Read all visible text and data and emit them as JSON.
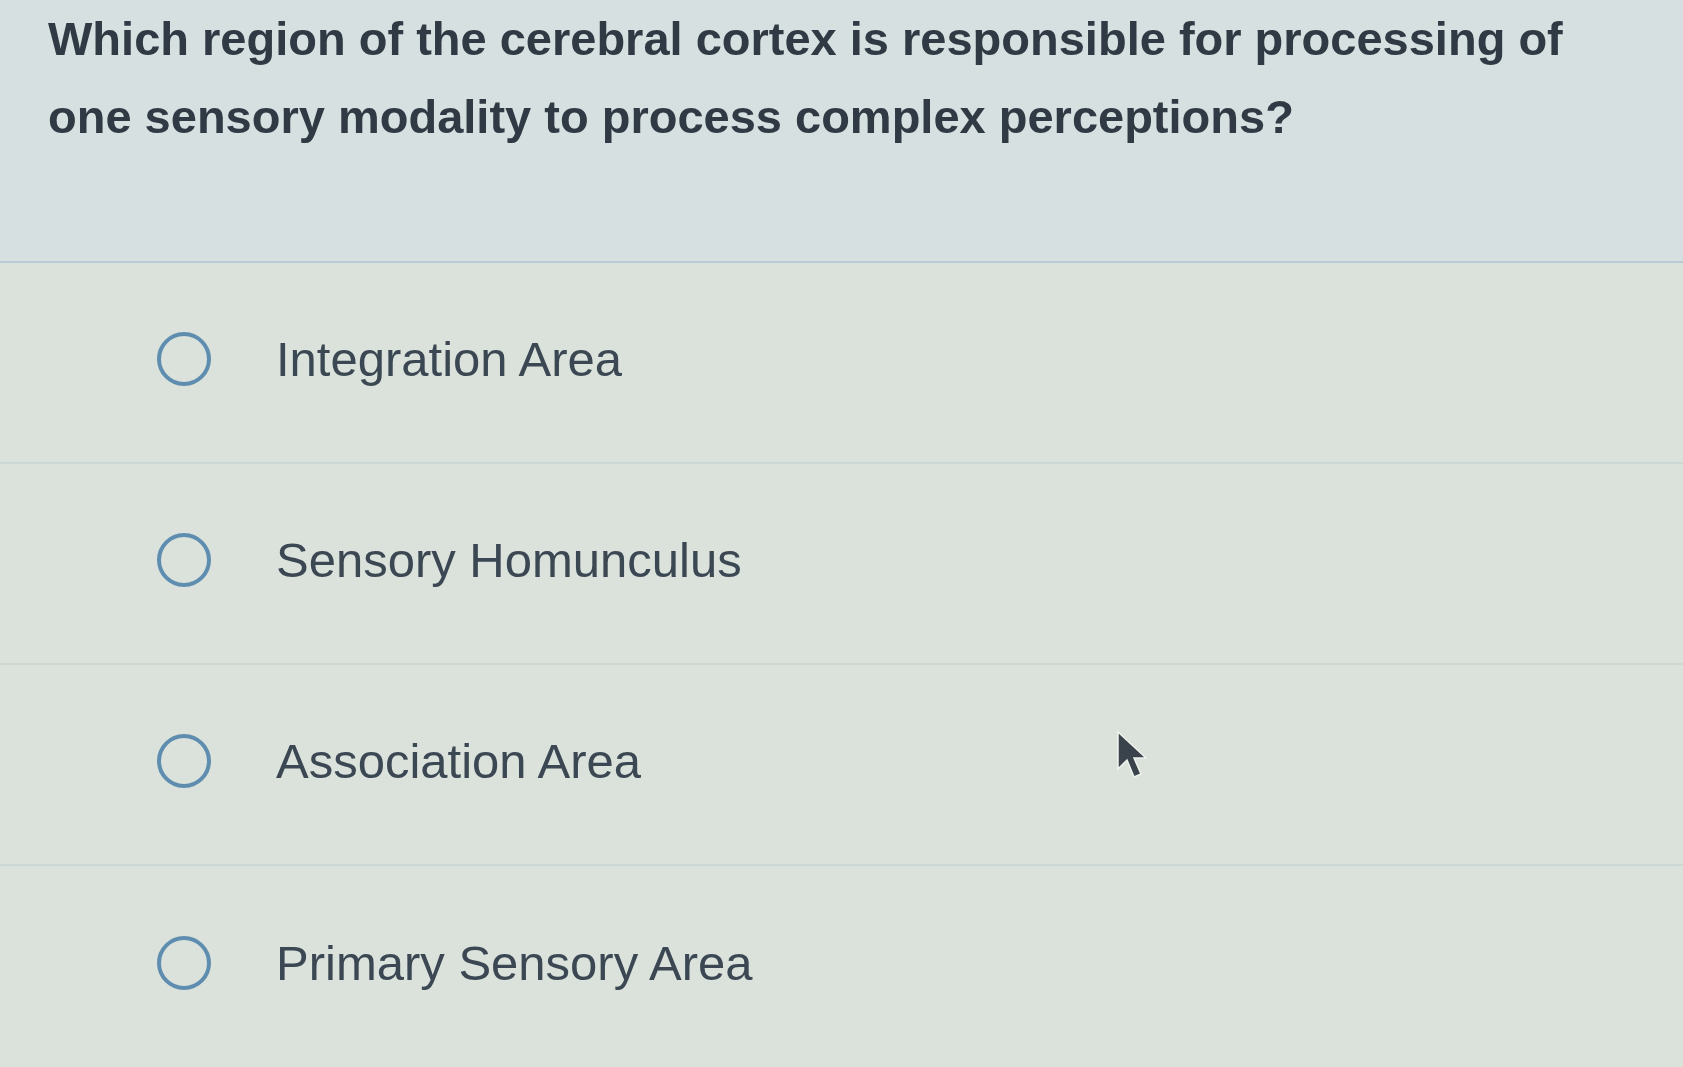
{
  "question": {
    "text": "Which region of the cerebral cortex is responsible for processing of one sensory modality to process complex perceptions?"
  },
  "options": [
    {
      "label": "Integration Area",
      "selected": false
    },
    {
      "label": "Sensory Homunculus",
      "selected": false
    },
    {
      "label": "Association Area",
      "selected": false
    },
    {
      "label": "Primary Sensory Area",
      "selected": false
    }
  ]
}
